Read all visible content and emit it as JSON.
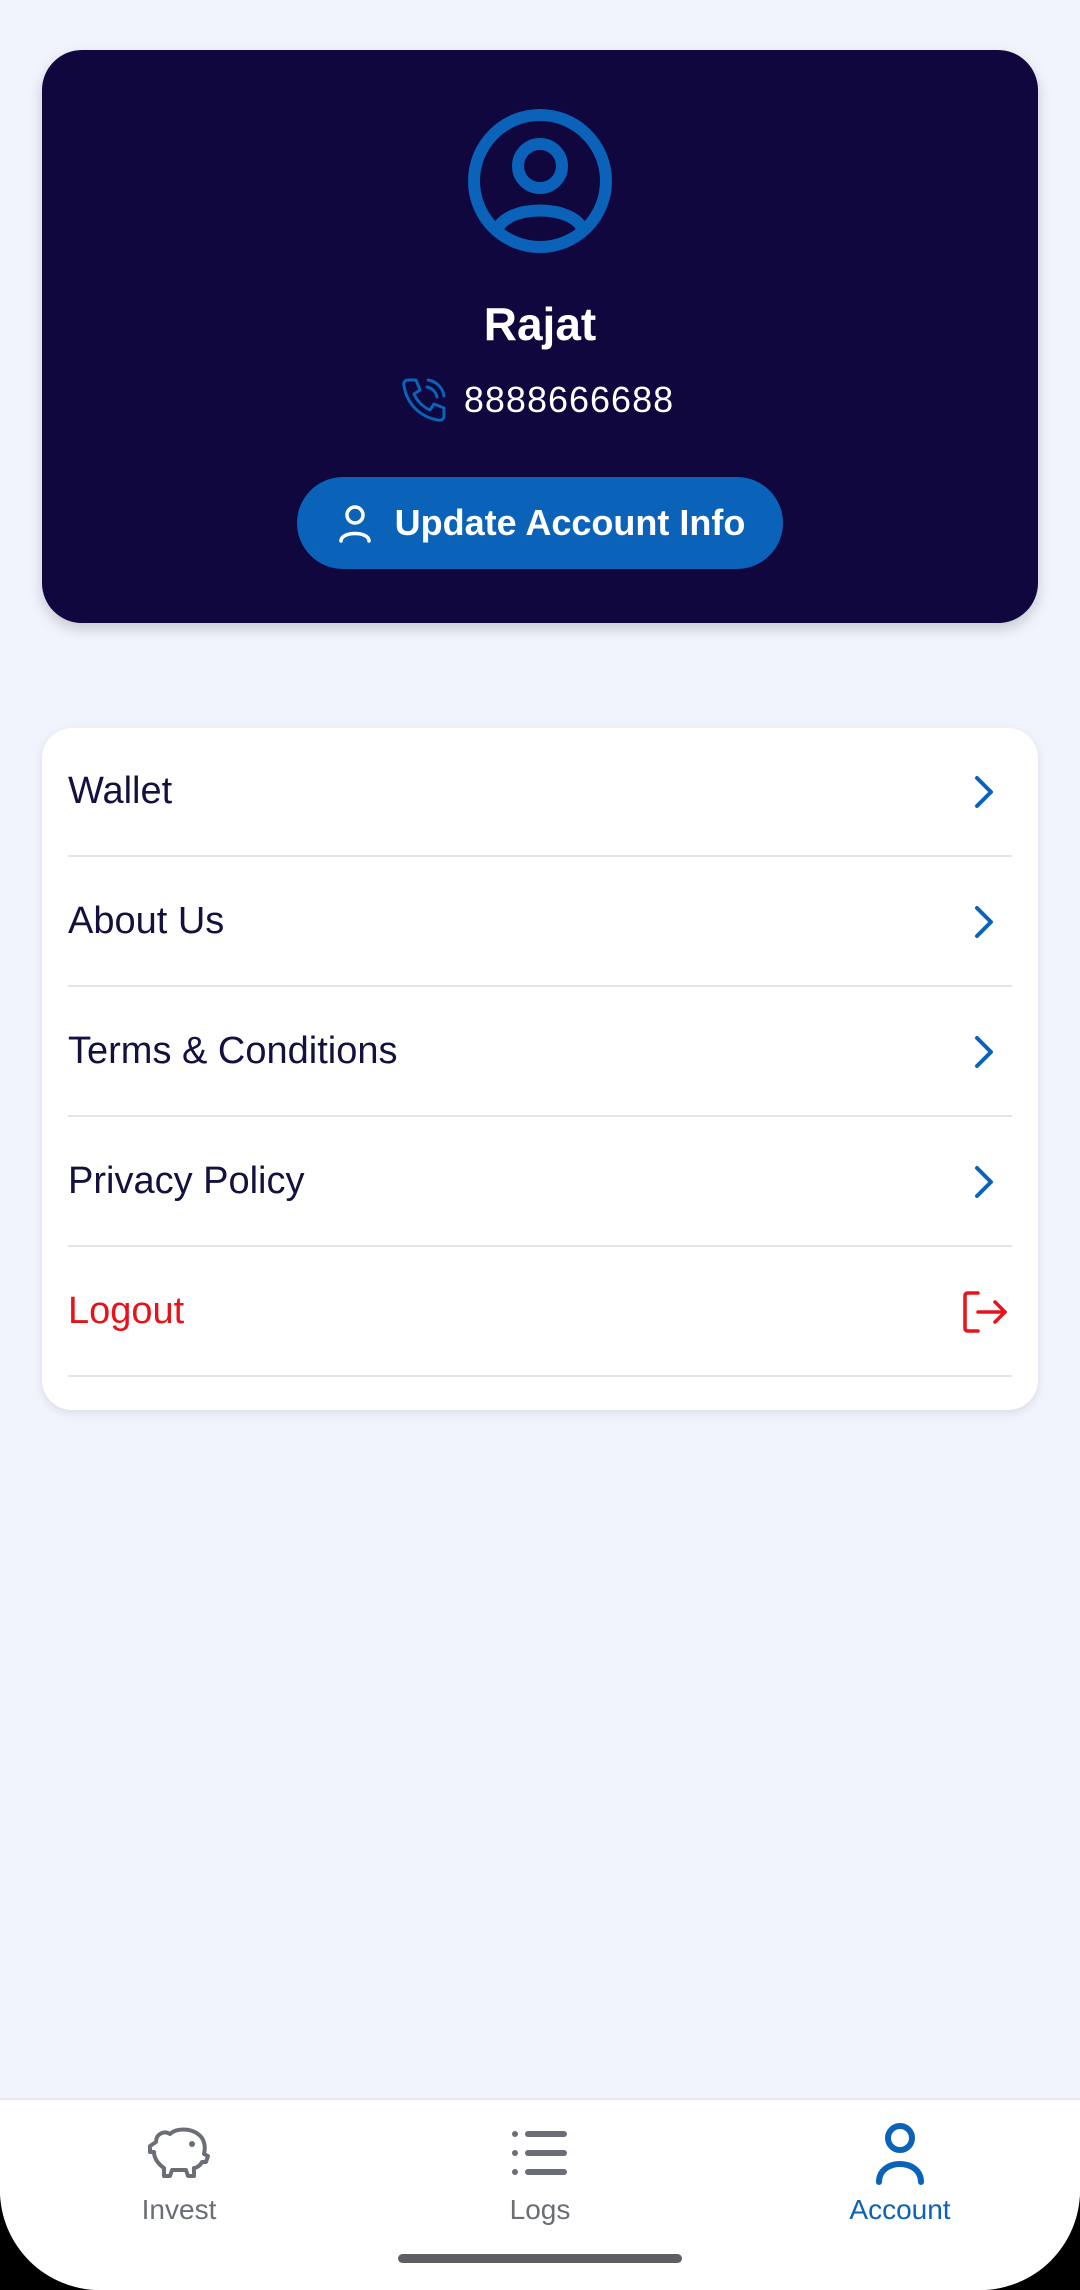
{
  "profile": {
    "name": "Rajat",
    "phone": "8888666688",
    "update_button_label": "Update Account Info",
    "avatar_icon": "user-circle-icon",
    "phone_icon": "phone-icon"
  },
  "menu": {
    "items": [
      {
        "label": "Wallet",
        "icon": "chevron-right-icon"
      },
      {
        "label": "About Us",
        "icon": "chevron-right-icon"
      },
      {
        "label": "Terms & Conditions",
        "icon": "chevron-right-icon"
      },
      {
        "label": "Privacy Policy",
        "icon": "chevron-right-icon"
      },
      {
        "label": "Logout",
        "icon": "logout-icon"
      }
    ]
  },
  "bottom_nav": {
    "items": [
      {
        "label": "Invest",
        "icon": "piggy-bank-icon",
        "active": false
      },
      {
        "label": "Logs",
        "icon": "list-icon",
        "active": false
      },
      {
        "label": "Account",
        "icon": "user-icon",
        "active": true
      }
    ]
  },
  "colors": {
    "card_dark": "#11073f",
    "accent_blue": "#0a63b8",
    "logout_red": "#e8121b",
    "background": "#f1f4fd"
  }
}
